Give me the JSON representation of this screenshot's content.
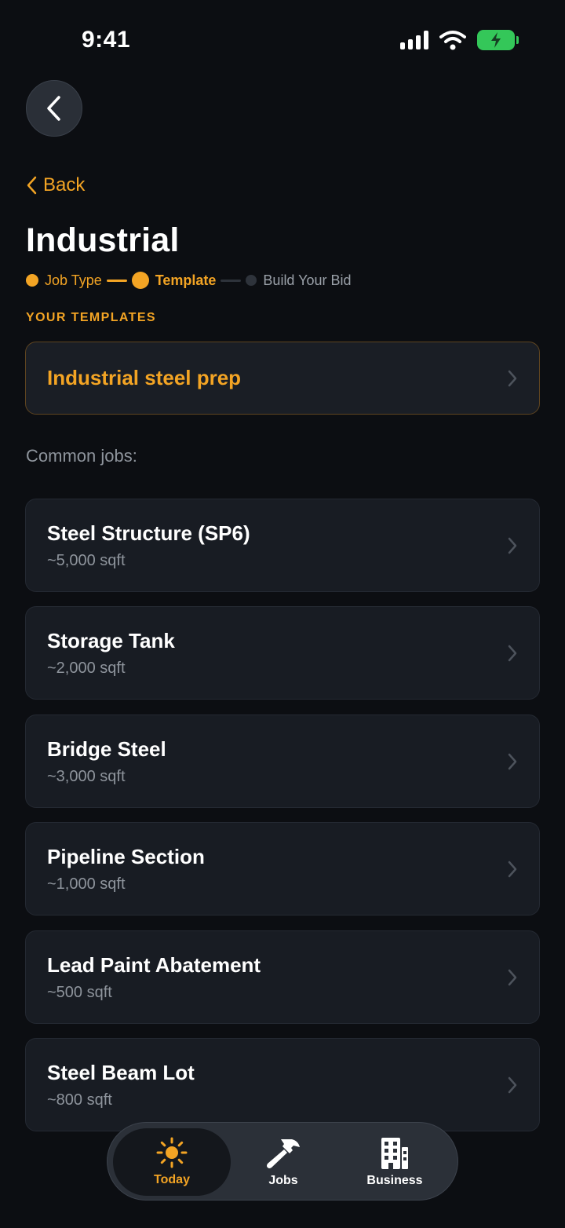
{
  "status_bar": {
    "time": "9:41"
  },
  "nav": {
    "back_label": "Back"
  },
  "page": {
    "title": "Industrial"
  },
  "stepper": {
    "steps": [
      {
        "label": "Job Type",
        "state": "done"
      },
      {
        "label": "Template",
        "state": "active"
      },
      {
        "label": "Build Your Bid",
        "state": "upcoming"
      }
    ]
  },
  "templates": {
    "section_label": "YOUR TEMPLATES",
    "items": [
      {
        "name": "Industrial steel prep"
      }
    ]
  },
  "common_jobs": {
    "label": "Common jobs:",
    "items": [
      {
        "title": "Steel Structure (SP6)",
        "size": "~5,000 sqft"
      },
      {
        "title": "Storage Tank",
        "size": "~2,000 sqft"
      },
      {
        "title": "Bridge Steel",
        "size": "~3,000 sqft"
      },
      {
        "title": "Pipeline Section",
        "size": "~1,000 sqft"
      },
      {
        "title": "Lead Paint Abatement",
        "size": "~500 sqft"
      },
      {
        "title": "Steel Beam Lot",
        "size": "~800 sqft"
      }
    ]
  },
  "tabbar": {
    "tabs": [
      {
        "label": "Today",
        "icon": "sun-icon",
        "active": true
      },
      {
        "label": "Jobs",
        "icon": "hammer-icon",
        "active": false
      },
      {
        "label": "Business",
        "icon": "building-icon",
        "active": false
      }
    ]
  },
  "colors": {
    "accent": "#f3a424",
    "background": "#0c0e12",
    "card": "#181c23",
    "battery": "#34c759"
  }
}
